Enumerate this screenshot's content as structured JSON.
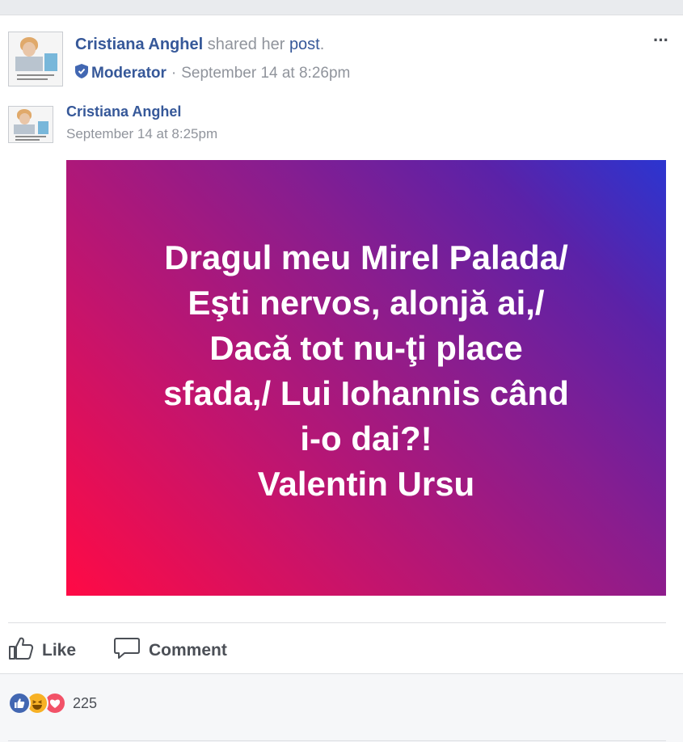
{
  "share_header": {
    "author": "Cristiana Anghel",
    "shared_text": "shared her",
    "post_link": "post",
    "period": ".",
    "badge": "Moderator",
    "separator": "·",
    "timestamp": "September 14 at 8:26pm"
  },
  "original_post": {
    "author": "Cristiana Anghel",
    "timestamp": "September 14 at 8:25pm",
    "lines": [
      "Dragul meu Mirel Palada/",
      "Eşti nervos, alonjă ai,/",
      "Dacă tot nu-ţi place",
      "sfada,/ Lui Iohannis când",
      "i-o dai?!",
      "Valentin Ursu"
    ],
    "gradient_colors": [
      "#ff0a45",
      "#c5146c",
      "#8a1d8e",
      "#5b22a8",
      "#2b35d0"
    ]
  },
  "actions": {
    "like_label": "Like",
    "comment_label": "Comment"
  },
  "reactions": {
    "icons": [
      "like-reaction",
      "haha-reaction",
      "love-reaction"
    ],
    "count": "225"
  },
  "more_menu_label": "···",
  "colors": {
    "link": "#365899",
    "muted": "#90949c",
    "text": "#4b4f56"
  }
}
